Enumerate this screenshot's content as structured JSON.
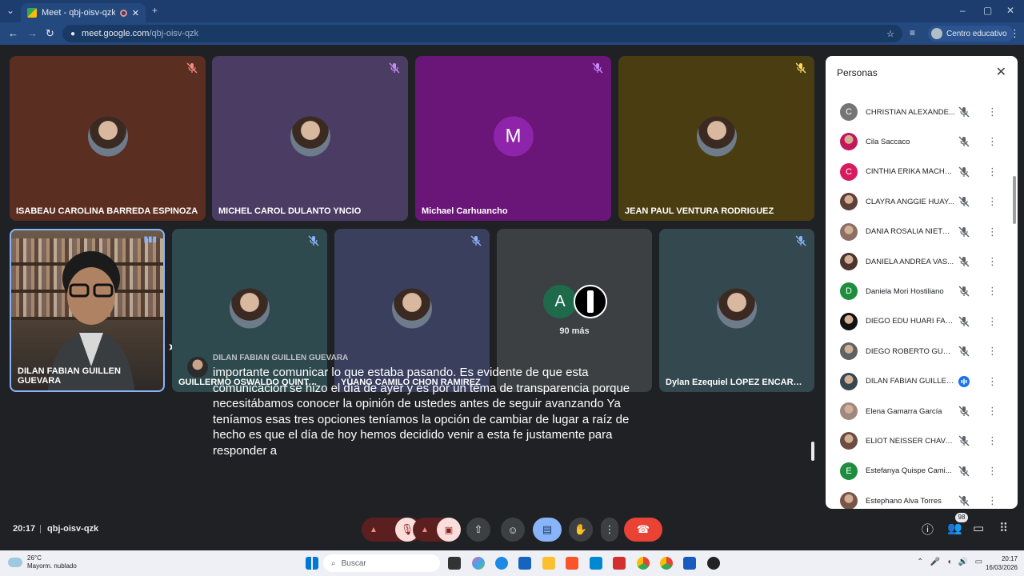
{
  "browser": {
    "tab_title": "Meet - qbj-oisv-qzk",
    "url_host": "meet.google.com",
    "url_path": "/qbj-oisv-qzk",
    "profile_label": "Centro educativo"
  },
  "tiles": [
    {
      "name": "ISABEAU CAROLINA BARREDA ESPINOZA",
      "bg": "#5b2e22",
      "avatar": "photo"
    },
    {
      "name": "MICHEL CAROL DULANTO YNCIO",
      "bg": "#4a3c63",
      "avatar": "photo"
    },
    {
      "name": "Michael Carhuancho",
      "bg": "#6a1578",
      "avatar": "letter",
      "letter": "M",
      "avatar_color": "#8e24aa"
    },
    {
      "name": "JEAN PAUL VENTURA RODRIGUEZ",
      "bg": "#4a3d12",
      "avatar": "photo"
    },
    {
      "name": "GUILLERMO OSWALDO QUINTA...",
      "bg": "#2e4a4e",
      "avatar": "photo"
    },
    {
      "name": "YUANG CAMILO CHON RAMIREZ",
      "bg": "#3a3f5e",
      "avatar": "photo"
    },
    {
      "name": "Dylan Ezequiel LÓPEZ ENCARNA...",
      "bg": "#33484f",
      "avatar": "photo"
    }
  ],
  "self_tile": {
    "name": "DILAN FABIAN GUILLEN GUEVARA"
  },
  "more_tile": {
    "letter": "A",
    "count_label": "90 más"
  },
  "caption": {
    "speaker": "DILAN FABIAN GUILLEN GUEVARA",
    "text": "importante comunicar lo que estaba pasando. Es evidente de que esta comunicación se hizo el día de ayer y es por un tema de transparencia porque necesitábamos conocer la opinión de ustedes antes de seguir avanzando Ya teníamos esas tres opciones teníamos la opción de cambiar de lugar a raíz de hecho es que el día de hoy hemos decidido venir a esta fe justamente para responder a"
  },
  "people_panel": {
    "title": "Personas",
    "people": [
      {
        "name": "CHRISTIAN ALEXANDE...",
        "avatar": "letter",
        "letter": "C",
        "color": "#757575"
      },
      {
        "name": "Cila Saccaco",
        "avatar": "photo",
        "color": "#c2185b"
      },
      {
        "name": "CINTHIA ERIKA MACHA...",
        "avatar": "letter",
        "letter": "C",
        "color": "#d81b60"
      },
      {
        "name": "CLAYRA ANGGIE HUAY...",
        "avatar": "photo",
        "color": "#5d4037"
      },
      {
        "name": "DANIA ROSALIA NIETO ...",
        "avatar": "photo",
        "color": "#8d6e63"
      },
      {
        "name": "DANIELA ANDREA VAS...",
        "avatar": "photo",
        "color": "#4e342e"
      },
      {
        "name": "Daniela Mori Hostiliano",
        "avatar": "letter",
        "letter": "D",
        "color": "#1e8e3e"
      },
      {
        "name": "DIEGO EDU HUARI FAJ...",
        "avatar": "photo",
        "color": "#111111"
      },
      {
        "name": "DIEGO ROBERTO GUTI...",
        "avatar": "photo",
        "color": "#616161"
      },
      {
        "name": "DILAN FABIAN GUILLEN...",
        "avatar": "photo",
        "color": "#37474f",
        "speaking": true
      },
      {
        "name": "Elena Gamarra García",
        "avatar": "photo",
        "color": "#a1887f"
      },
      {
        "name": "ELIOT NEISSER CHAVAR...",
        "avatar": "photo",
        "color": "#6d4c41"
      },
      {
        "name": "Estefanya Quispe Cami...",
        "avatar": "letter",
        "letter": "E",
        "color": "#1e8e3e"
      },
      {
        "name": "Estephano Alva Torres",
        "avatar": "photo",
        "color": "#795548"
      }
    ]
  },
  "bottom_bar": {
    "time": "20:17",
    "separator": "|",
    "meeting_code": "qbj-oisv-qzk",
    "people_count": "98"
  },
  "taskbar": {
    "temperature": "26°C",
    "weather": "Mayorm. nublado",
    "search_placeholder": "Buscar",
    "time": "20:17",
    "date": "16/03/2026"
  }
}
